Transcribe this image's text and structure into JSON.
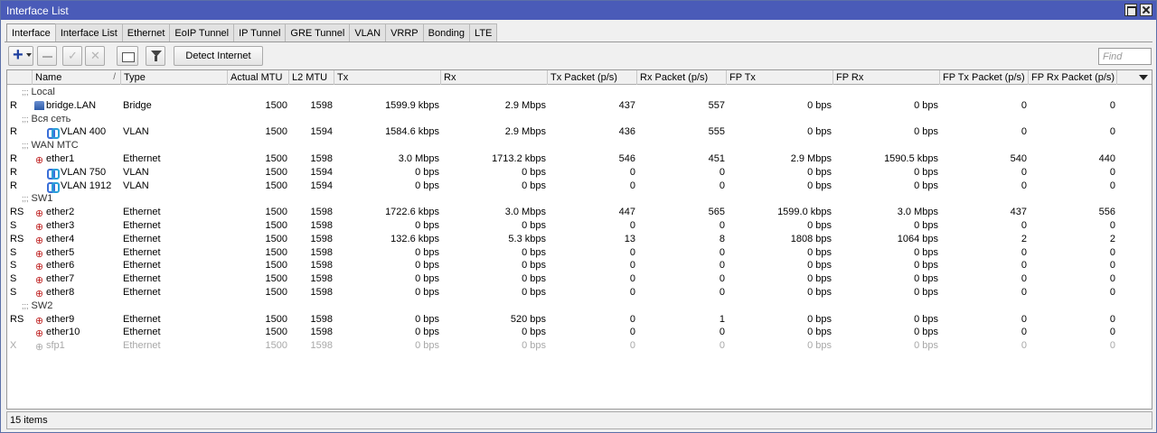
{
  "window": {
    "title": "Interface List"
  },
  "tabs": [
    "Interface",
    "Interface List",
    "Ethernet",
    "EoIP Tunnel",
    "IP Tunnel",
    "GRE Tunnel",
    "VLAN",
    "VRRP",
    "Bonding",
    "LTE"
  ],
  "toolbar": {
    "detect_label": "Detect Internet",
    "find_placeholder": "Find"
  },
  "columns": [
    "Name",
    "Type",
    "Actual MTU",
    "L2 MTU",
    "Tx",
    "Rx",
    "Tx Packet (p/s)",
    "Rx Packet (p/s)",
    "FP Tx",
    "FP Rx",
    "FP Tx Packet (p/s)",
    "FP Rx Packet (p/s)"
  ],
  "rows": [
    {
      "group": ";;; Local"
    },
    {
      "flag": "R",
      "icon": "bridge-icon",
      "name": "bridge.LAN",
      "type": "Bridge",
      "mtu": "1500",
      "l2mtu": "1598",
      "tx": "1599.9 kbps",
      "rx": "2.9 Mbps",
      "txp": "437",
      "rxp": "557",
      "fptx": "0 bps",
      "fprx": "0 bps",
      "fptxp": "0",
      "fprxp": "0"
    },
    {
      "group": ";;; Вся сеть"
    },
    {
      "flag": "R",
      "icon": "vlan-icon",
      "indent": true,
      "name": "VLAN 400",
      "type": "VLAN",
      "mtu": "1500",
      "l2mtu": "1594",
      "tx": "1584.6 kbps",
      "rx": "2.9 Mbps",
      "txp": "436",
      "rxp": "555",
      "fptx": "0 bps",
      "fprx": "0 bps",
      "fptxp": "0",
      "fprxp": "0"
    },
    {
      "group": ";;; WAN МТС"
    },
    {
      "flag": "R",
      "icon": "ethernet-icon",
      "name": "ether1",
      "type": "Ethernet",
      "mtu": "1500",
      "l2mtu": "1598",
      "tx": "3.0 Mbps",
      "rx": "1713.2 kbps",
      "txp": "546",
      "rxp": "451",
      "fptx": "2.9 Mbps",
      "fprx": "1590.5 kbps",
      "fptxp": "540",
      "fprxp": "440"
    },
    {
      "flag": "R",
      "icon": "vlan-icon",
      "indent": true,
      "name": "VLAN 750",
      "type": "VLAN",
      "mtu": "1500",
      "l2mtu": "1594",
      "tx": "0 bps",
      "rx": "0 bps",
      "txp": "0",
      "rxp": "0",
      "fptx": "0 bps",
      "fprx": "0 bps",
      "fptxp": "0",
      "fprxp": "0"
    },
    {
      "flag": "R",
      "icon": "vlan-icon",
      "indent": true,
      "name": "VLAN 1912",
      "type": "VLAN",
      "mtu": "1500",
      "l2mtu": "1594",
      "tx": "0 bps",
      "rx": "0 bps",
      "txp": "0",
      "rxp": "0",
      "fptx": "0 bps",
      "fprx": "0 bps",
      "fptxp": "0",
      "fprxp": "0"
    },
    {
      "group": ";;; SW1"
    },
    {
      "flag": "RS",
      "icon": "ethernet-icon",
      "name": "ether2",
      "type": "Ethernet",
      "mtu": "1500",
      "l2mtu": "1598",
      "tx": "1722.6 kbps",
      "rx": "3.0 Mbps",
      "txp": "447",
      "rxp": "565",
      "fptx": "1599.0 kbps",
      "fprx": "3.0 Mbps",
      "fptxp": "437",
      "fprxp": "556"
    },
    {
      "flag": "S",
      "icon": "ethernet-icon",
      "name": "ether3",
      "type": "Ethernet",
      "mtu": "1500",
      "l2mtu": "1598",
      "tx": "0 bps",
      "rx": "0 bps",
      "txp": "0",
      "rxp": "0",
      "fptx": "0 bps",
      "fprx": "0 bps",
      "fptxp": "0",
      "fprxp": "0"
    },
    {
      "flag": "RS",
      "icon": "ethernet-icon",
      "name": "ether4",
      "type": "Ethernet",
      "mtu": "1500",
      "l2mtu": "1598",
      "tx": "132.6 kbps",
      "rx": "5.3 kbps",
      "txp": "13",
      "rxp": "8",
      "fptx": "1808 bps",
      "fprx": "1064 bps",
      "fptxp": "2",
      "fprxp": "2"
    },
    {
      "flag": "S",
      "icon": "ethernet-icon",
      "name": "ether5",
      "type": "Ethernet",
      "mtu": "1500",
      "l2mtu": "1598",
      "tx": "0 bps",
      "rx": "0 bps",
      "txp": "0",
      "rxp": "0",
      "fptx": "0 bps",
      "fprx": "0 bps",
      "fptxp": "0",
      "fprxp": "0"
    },
    {
      "flag": "S",
      "icon": "ethernet-icon",
      "name": "ether6",
      "type": "Ethernet",
      "mtu": "1500",
      "l2mtu": "1598",
      "tx": "0 bps",
      "rx": "0 bps",
      "txp": "0",
      "rxp": "0",
      "fptx": "0 bps",
      "fprx": "0 bps",
      "fptxp": "0",
      "fprxp": "0"
    },
    {
      "flag": "S",
      "icon": "ethernet-icon",
      "name": "ether7",
      "type": "Ethernet",
      "mtu": "1500",
      "l2mtu": "1598",
      "tx": "0 bps",
      "rx": "0 bps",
      "txp": "0",
      "rxp": "0",
      "fptx": "0 bps",
      "fprx": "0 bps",
      "fptxp": "0",
      "fprxp": "0"
    },
    {
      "flag": "S",
      "icon": "ethernet-icon",
      "name": "ether8",
      "type": "Ethernet",
      "mtu": "1500",
      "l2mtu": "1598",
      "tx": "0 bps",
      "rx": "0 bps",
      "txp": "0",
      "rxp": "0",
      "fptx": "0 bps",
      "fprx": "0 bps",
      "fptxp": "0",
      "fprxp": "0"
    },
    {
      "group": ";;; SW2"
    },
    {
      "flag": "RS",
      "icon": "ethernet-icon",
      "name": "ether9",
      "type": "Ethernet",
      "mtu": "1500",
      "l2mtu": "1598",
      "tx": "0 bps",
      "rx": "520 bps",
      "txp": "0",
      "rxp": "1",
      "fptx": "0 bps",
      "fprx": "0 bps",
      "fptxp": "0",
      "fprxp": "0"
    },
    {
      "flag": "",
      "icon": "ethernet-icon",
      "name": "ether10",
      "type": "Ethernet",
      "mtu": "1500",
      "l2mtu": "1598",
      "tx": "0 bps",
      "rx": "0 bps",
      "txp": "0",
      "rxp": "0",
      "fptx": "0 bps",
      "fprx": "0 bps",
      "fptxp": "0",
      "fprxp": "0"
    },
    {
      "flag": "X",
      "icon": "ethernet-icon",
      "disabled": true,
      "name": "sfp1",
      "type": "Ethernet",
      "mtu": "1500",
      "l2mtu": "1598",
      "tx": "0 bps",
      "rx": "0 bps",
      "txp": "0",
      "rxp": "0",
      "fptx": "0 bps",
      "fprx": "0 bps",
      "fptxp": "0",
      "fprxp": "0"
    }
  ],
  "status": {
    "count": "15 items"
  }
}
